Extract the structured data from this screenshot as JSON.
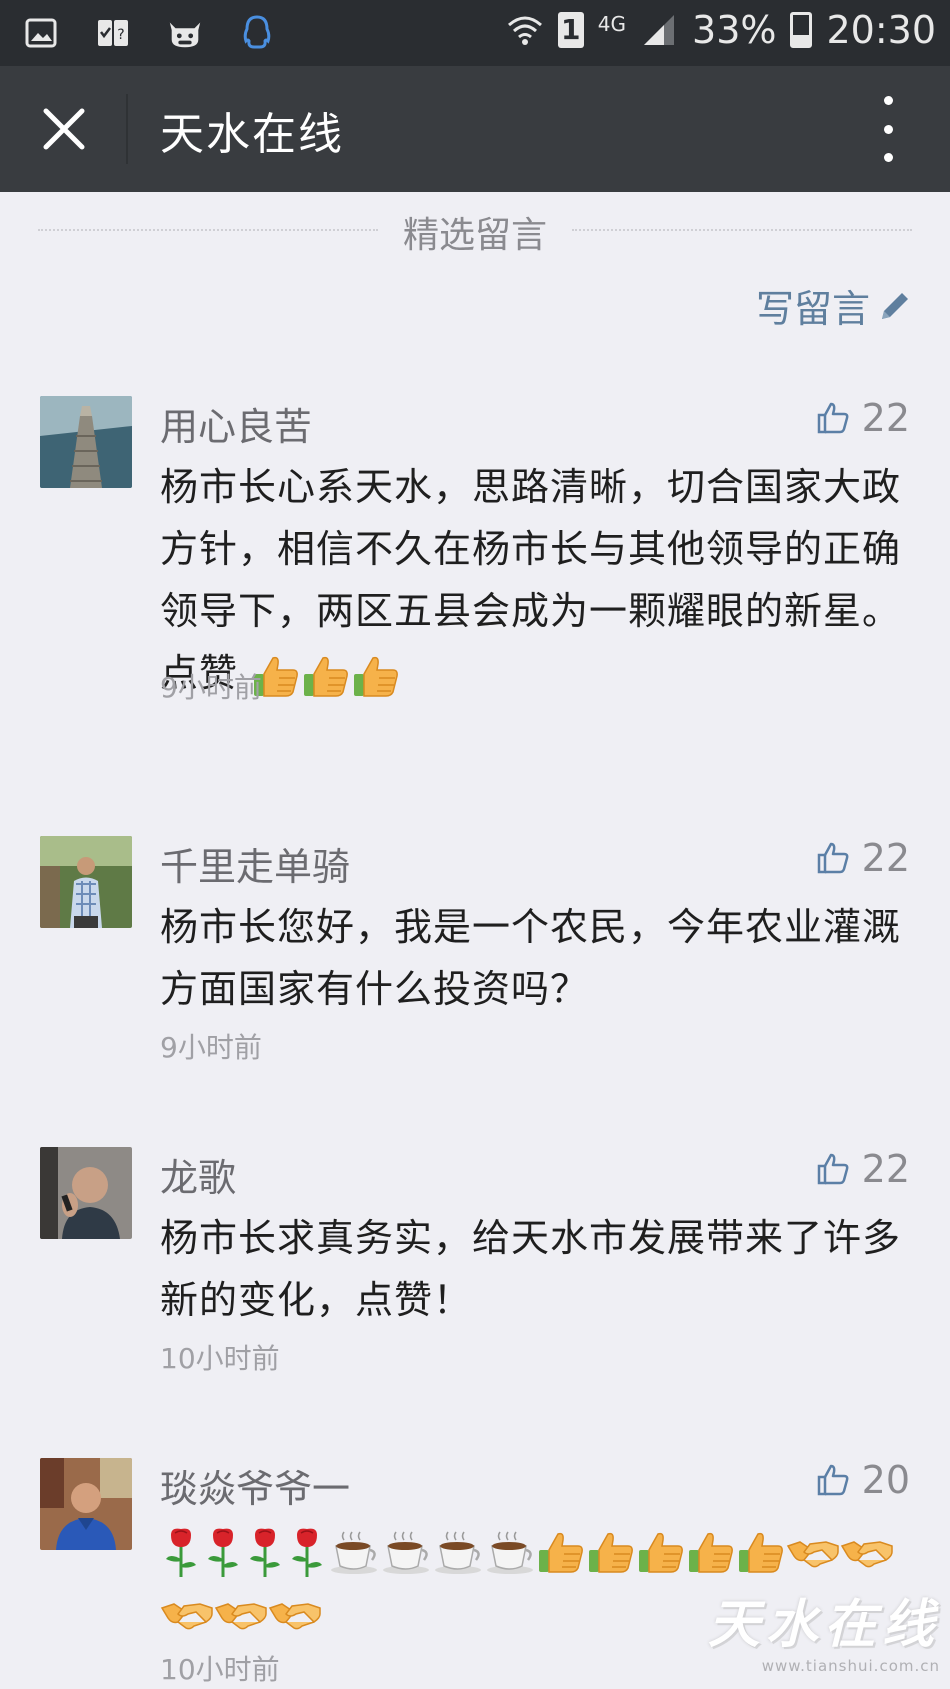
{
  "status_bar": {
    "network": "4G",
    "sim_slot": "1",
    "battery": "33%",
    "battery_level": 0.33,
    "time": "20:30",
    "icons": [
      "gallery-icon",
      "sim-toolkit-icon",
      "cow-app-icon",
      "qq-icon",
      "wifi-icon",
      "signal-icon",
      "battery-icon"
    ]
  },
  "title_bar": {
    "title": "天水在线",
    "close_icon": "close-icon",
    "more_icon": "more-vertical-icon"
  },
  "section": {
    "title": "精选留言",
    "write_label": "写留言",
    "write_icon": "pencil-icon"
  },
  "comments": [
    {
      "name": "用心良苦",
      "likes": "22",
      "text": "杨市长心系天水，思路清晰，切合国家大政方针，相信不久在杨市长与其他领导的正确领导下，两区五县会成为一颗耀眼的新星。点赞",
      "emoji": [
        "thumbs-up",
        "thumbs-up",
        "thumbs-up"
      ],
      "time": "9小时前"
    },
    {
      "name": "千里走单骑",
      "likes": "22",
      "text": "杨市长您好，我是一个农民，今年农业灌溉方面国家有什么投资吗？",
      "emoji": [],
      "time": "9小时前"
    },
    {
      "name": "龙歌",
      "likes": "22",
      "text": "杨市长求真务实，给天水市发展带来了许多新的变化，点赞！",
      "emoji": [],
      "time": "10小时前"
    },
    {
      "name": "琰焱爷爷一",
      "likes": "20",
      "text": "",
      "emoji": [
        "rose",
        "rose",
        "rose",
        "rose",
        "coffee",
        "coffee",
        "coffee",
        "coffee",
        "thumbs-up",
        "thumbs-up",
        "thumbs-up",
        "thumbs-up",
        "thumbs-up",
        "handshake",
        "handshake",
        "handshake",
        "handshake",
        "handshake"
      ],
      "time": "10小时前"
    }
  ],
  "watermark": {
    "text": "天水在线",
    "url": "www.tianshui.com.cn"
  },
  "colors": {
    "status_bar": "#2a2d31",
    "title_bar": "#393c40",
    "background": "#efeff4",
    "link": "#5f7f9e",
    "like_icon": "#5b7fa6"
  }
}
